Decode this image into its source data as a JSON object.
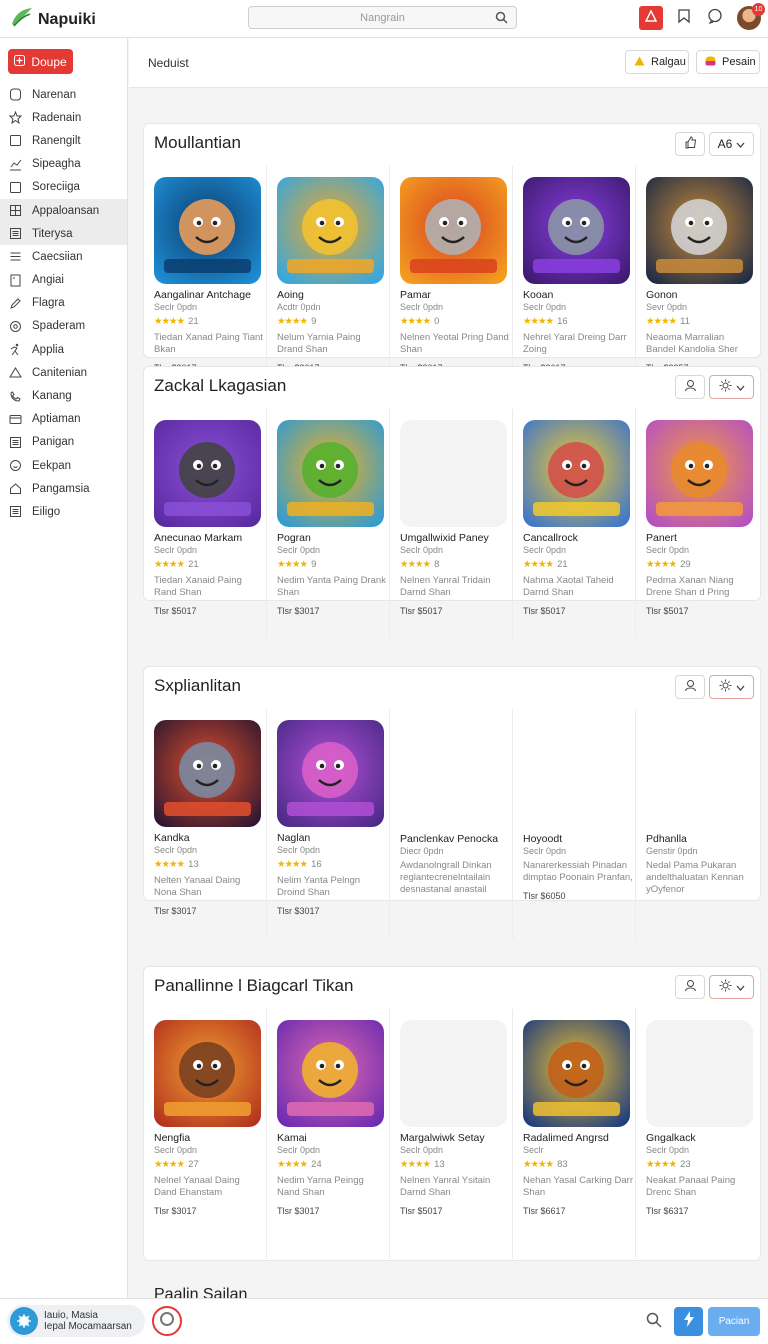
{
  "app": {
    "name": "Napuiki"
  },
  "header": {
    "search_placeholder": "Nangrain",
    "notification_count": "10"
  },
  "sidebar": {
    "new_button_label": "Doupe",
    "items": [
      {
        "label": "Narenan",
        "icon": "person-icon"
      },
      {
        "label": "Radenain",
        "icon": "star-icon"
      },
      {
        "label": "Ranengilt",
        "icon": "square-icon"
      },
      {
        "label": "Sipeagha",
        "icon": "chart-icon"
      },
      {
        "label": "Soreciiga",
        "icon": "square-icon"
      },
      {
        "label": "Appaloansan",
        "icon": "grid-icon"
      },
      {
        "label": "Titerysa",
        "icon": "list-icon"
      },
      {
        "label": "Caecsiian",
        "icon": "menu-icon"
      },
      {
        "label": "Angiai",
        "icon": "document-icon"
      },
      {
        "label": "Flagra",
        "icon": "pencil-icon"
      },
      {
        "label": "Spaderam",
        "icon": "circle-icon"
      },
      {
        "label": "Applia",
        "icon": "runner-icon"
      },
      {
        "label": "Canitenian",
        "icon": "triangle-icon"
      },
      {
        "label": "Kanang",
        "icon": "phone-icon"
      },
      {
        "label": "Aptiaman",
        "icon": "card-icon"
      },
      {
        "label": "Panigan",
        "icon": "list-icon"
      },
      {
        "label": "Eekpan",
        "icon": "smiley-icon"
      },
      {
        "label": "Pangamsia",
        "icon": "house-icon"
      },
      {
        "label": "Eiligo",
        "icon": "list-icon"
      }
    ]
  },
  "topbar": {
    "label": "Neduist",
    "btn1": "Ralgau",
    "btn2": "Pesain"
  },
  "sections": [
    {
      "title": "Moullantian",
      "btn_label": "A6",
      "cards": [
        {
          "title": "Aangalinar Antchage",
          "sub": "Seclr 0pdn",
          "rating": "21",
          "desc": "Tiedan Xanad Paing Tiant Bkan",
          "price": "Tlsr $3017"
        },
        {
          "title": "Aoing",
          "sub": "Acdtr 0pdn",
          "rating": "9",
          "desc": "Nelum Yarnia Paing Drand Shan",
          "price": "Tlsr $3017"
        },
        {
          "title": "Pamar",
          "sub": "Seclr 0pdn",
          "rating": "0",
          "desc": "Nelnen Yeotal Pring Dand Shan",
          "price": "Tlsr $3017"
        },
        {
          "title": "Kooan",
          "sub": "Seclr 0pdn",
          "rating": "16",
          "desc": "Nehrel Yaral Dreing Darr Zoing",
          "price": "Tlsr $3617"
        },
        {
          "title": "Gonon",
          "sub": "Sevr 0pdn",
          "rating": "11",
          "desc": "Neaoma Marralian Bandel Kandolia Sher",
          "price": "Tlsr $3257"
        }
      ]
    },
    {
      "title": "Zackal Lkagasian",
      "cards": [
        {
          "title": "Anecunao Markam",
          "sub": "Seclr 0pdn",
          "rating": "21",
          "desc": "Tiedan Xanaid Paing Rand Shan",
          "price": "Tlsr $5017"
        },
        {
          "title": "Pogran",
          "sub": "Seclr 0pdn",
          "rating": "9",
          "desc": "Nedim Yanta Paing Drank Shan",
          "price": "Tlsr $3017"
        },
        {
          "title": "Umgallwixid Paney",
          "sub": "Seclr 0pdn",
          "rating": "8",
          "desc": "Nelnen Yanral Tridain Darnd Shan",
          "price": "Tlsr $5017"
        },
        {
          "title": "Cancallrock",
          "sub": "Seclr 0pdn",
          "rating": "21",
          "desc": "Nahma Xaotal Taheid Darnd Shan",
          "price": "Tlsr $5017"
        },
        {
          "title": "Panert",
          "sub": "Seclr 0pdn",
          "rating": "29",
          "desc": "Pedma Xanan Niang Drene Shan d Pring",
          "price": "Tlsr $5017"
        }
      ]
    },
    {
      "title": "Sxplianlitan",
      "cards": [
        {
          "title": "Kandka",
          "sub": "Seclr 0pdn",
          "rating": "13",
          "desc": "Nelten Yanaal Daing Nona Shan",
          "price": "Tlsr $3017"
        },
        {
          "title": "Naglan",
          "sub": "Seclr 0pdn",
          "rating": "16",
          "desc": "Nelim Yanta Pelngn Droind Shan",
          "price": "Tlsr $3017"
        },
        {
          "title": "Panclenkav Penocka",
          "sub": "Diecr 0pdn",
          "desc": "Awdanolngrall Dinkan reglantecrenelntailain desnastanal anastail"
        },
        {
          "title": "Hoyoodt",
          "sub": "Seclr 0pdn",
          "desc": "Nanarerkessiah Pinadan dimptao Poonain Pranfan,",
          "price": "Tlsr $6050"
        },
        {
          "title": "Pdhanlla",
          "sub": "Genstir 0pdn",
          "desc": "Nedal Pama Pukaran andelthaluatan Kennan yOyfenor"
        }
      ]
    },
    {
      "title": "Panallinne l Biagcarl Tikan",
      "cards": [
        {
          "title": "Nengfia",
          "sub": "Seclr 0pdn",
          "rating": "27",
          "desc": "Nelnel Yanaal Daing Dand Ehanstam",
          "price": "Tlsr $3017"
        },
        {
          "title": "Kamai",
          "sub": "Seclr 0pdn",
          "rating": "24",
          "desc": "Nedim Yarna Peingg Nand Shan",
          "price": "Tlsr $3017"
        },
        {
          "title": "Margalwiwk Setay",
          "sub": "Seclr 0pdn",
          "rating": "13",
          "desc": "Nelnen Yanral Ysitain Darnd Shan",
          "price": "Tlsr $5017"
        },
        {
          "title": "Radalimed Angrsd",
          "sub": "Seclr",
          "rating": "83",
          "desc": "Nehan Yasal Carking Darr Shan",
          "price": "Tlsr $6617"
        },
        {
          "title": "Gngalkack",
          "sub": "Seclr 0pdn",
          "rating": "23",
          "desc": "Neakat Panaal Paing Drenc Shan",
          "price": "Tlsr $6317"
        }
      ]
    }
  ],
  "partial_section_title": "Paalin Sailan",
  "footer": {
    "user_line1": "Iauio, Masia",
    "user_line2": "Iepal Mocamaarsan",
    "button_label": "Pacian"
  },
  "colors": {
    "accent": "#e53935",
    "star": "#f1b400",
    "primary_blue": "#3a8fe0"
  }
}
